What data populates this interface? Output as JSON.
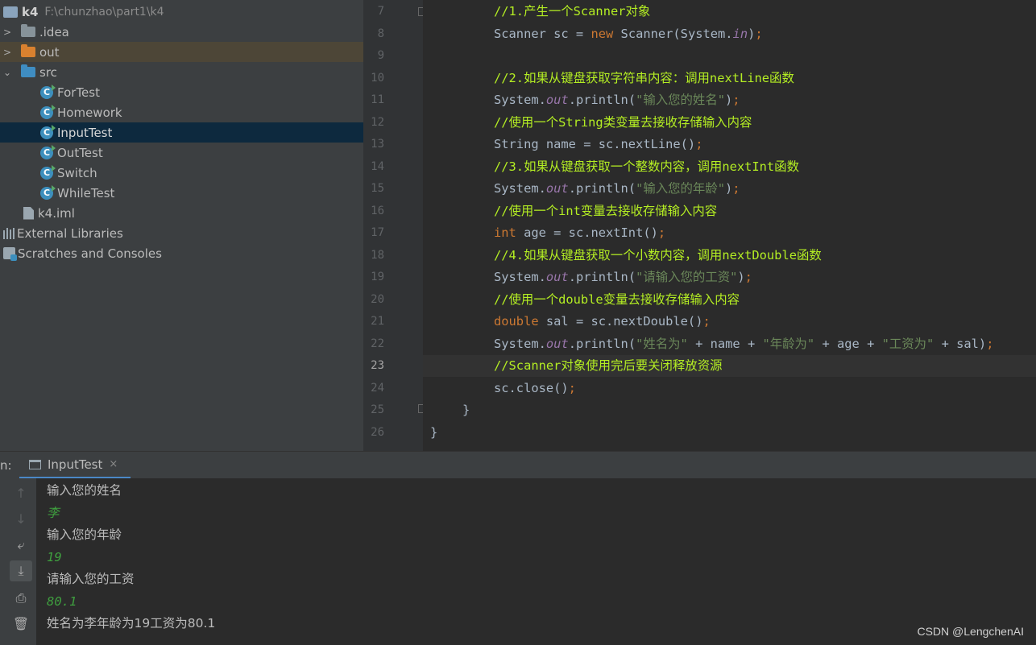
{
  "project": {
    "root": {
      "name": "k4",
      "path": "F:\\chunzhao\\part1\\k4"
    },
    "items": [
      {
        "label": ".idea",
        "arrow": ">"
      },
      {
        "label": "out",
        "arrow": ">"
      },
      {
        "label": "src",
        "arrow": "⌄"
      },
      {
        "label": "ForTest"
      },
      {
        "label": "Homework"
      },
      {
        "label": "InputTest"
      },
      {
        "label": "OutTest"
      },
      {
        "label": "Switch"
      },
      {
        "label": "WhileTest"
      },
      {
        "label": "k4.iml"
      },
      {
        "label": "External Libraries"
      },
      {
        "label": "Scratches and Consoles"
      }
    ]
  },
  "editor": {
    "line_numbers": [
      "7",
      "8",
      "9",
      "10",
      "11",
      "12",
      "13",
      "14",
      "15",
      "16",
      "17",
      "18",
      "19",
      "20",
      "21",
      "22",
      "23",
      "24",
      "25",
      "26"
    ],
    "current_line": "23",
    "lines": {
      "l7": {
        "c": "//1.产生一个Scanner对象"
      },
      "l8": {
        "a": "Scanner sc = ",
        "kw": "new",
        "b": " Scanner(System.",
        "st": "in",
        "c": ")",
        "p": ";"
      },
      "l10": {
        "c": "//2.如果从键盘获取字符串内容：调用nextLine函数"
      },
      "l11": {
        "a": "System.",
        "st": "out",
        "b": ".println(",
        "s": "\"输入您的姓名\"",
        "c": ")",
        "p": ";"
      },
      "l12": {
        "c": "//使用一个String类变量去接收存储输入内容"
      },
      "l13": {
        "a": "String name = sc.nextLine()",
        "p": ";"
      },
      "l14": {
        "c": "//3.如果从键盘获取一个整数内容，调用nextInt函数"
      },
      "l15": {
        "a": "System.",
        "st": "out",
        "b": ".println(",
        "s": "\"输入您的年龄\"",
        "c": ")",
        "p": ";"
      },
      "l16": {
        "c": "//使用一个int变量去接收存储输入内容"
      },
      "l17": {
        "kw": "int",
        "a": " age = sc.nextInt()",
        "p": ";"
      },
      "l18": {
        "c": "//4.如果从键盘获取一个小数内容，调用nextDouble函数"
      },
      "l19": {
        "a": "System.",
        "st": "out",
        "b": ".println(",
        "s": "\"请输入您的工资\"",
        "c": ")",
        "p": ";"
      },
      "l20": {
        "c": "//使用一个double变量去接收存储输入内容"
      },
      "l21": {
        "kw": "double",
        "a": " sal = sc.nextDouble()",
        "p": ";"
      },
      "l22": {
        "a": "System.",
        "st": "out",
        "b": ".println(",
        "s1": "\"姓名为\"",
        "m1": " + name + ",
        "s2": "\"年龄为\"",
        "m2": " + age + ",
        "s3": "\"工资为\"",
        "m3": " + sal)",
        "p": ";"
      },
      "l23": {
        "c": "//Scanner对象使用完后要关闭释放资源"
      },
      "l24": {
        "a": "sc.close()",
        "p": ";"
      },
      "l25": {
        "a": "}"
      },
      "l26": {
        "a": "}"
      }
    }
  },
  "run": {
    "label": "n:",
    "tab": "InputTest",
    "close": "×",
    "output": [
      {
        "text": "输入您的姓名",
        "kind": "sys"
      },
      {
        "text": "李",
        "kind": "usr"
      },
      {
        "text": "输入您的年龄",
        "kind": "sys"
      },
      {
        "text": "19",
        "kind": "usr"
      },
      {
        "text": "请输入您的工资",
        "kind": "sys"
      },
      {
        "text": "80.1",
        "kind": "usr"
      },
      {
        "text": "姓名为李年龄为19工资为80.1",
        "kind": "sys"
      }
    ],
    "toolbar_icons": [
      "arrow-up-icon",
      "arrow-down-icon",
      "soft-wrap-icon",
      "scroll-to-end-icon",
      "print-icon",
      "trash-icon"
    ]
  },
  "watermark": "CSDN @LengchenAI",
  "colors": {
    "selection": "#0d293e",
    "out_folder": "#4d4637",
    "comment": "#b4ee23",
    "keyword": "#cc7832",
    "string": "#6a8759",
    "user_input": "#3f9f3f"
  }
}
